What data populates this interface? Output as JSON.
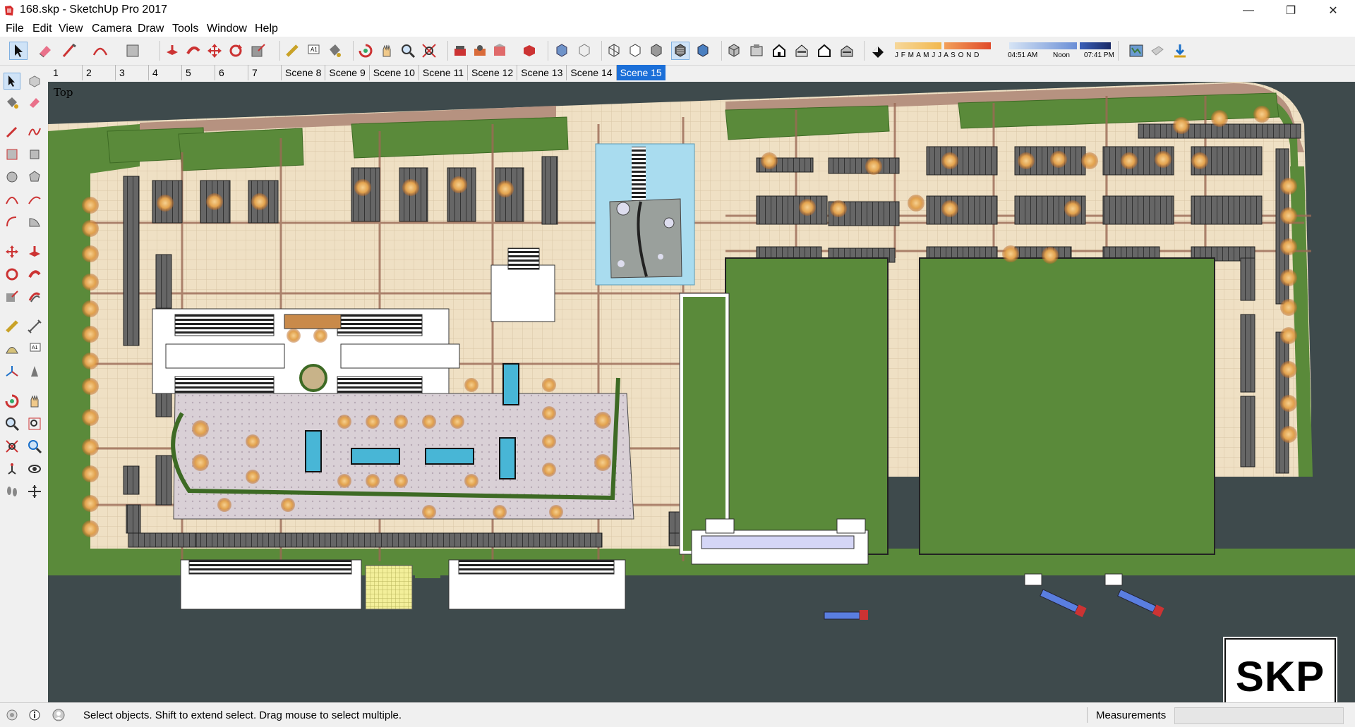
{
  "window": {
    "title": "168.skp - SketchUp Pro 2017",
    "minimize": "—",
    "maximize": "❐",
    "close": "✕"
  },
  "menu": [
    "File",
    "Edit",
    "View",
    "Camera",
    "Draw",
    "Tools",
    "Window",
    "Help"
  ],
  "shadow_months": "J F M A M J J A S O N D",
  "shadow_times": {
    "start": "04:51 AM",
    "mid": "Noon",
    "end": "07:41 PM"
  },
  "scenes": [
    "1",
    "2",
    "3",
    "4",
    "5",
    "6",
    "7",
    "Scene 8",
    "Scene 9",
    "Scene 10",
    "Scene 11",
    "Scene 12",
    "Scene 13",
    "Scene 14",
    "Scene 15"
  ],
  "active_scene": "Scene 15",
  "viewport": {
    "view_label": "Top"
  },
  "status": {
    "hint": "Select objects. Shift to extend select. Drag mouse to select multiple.",
    "measurements_label": "Measurements",
    "measurements_value": ""
  },
  "logo": {
    "text": "SKP"
  },
  "colors": {
    "active_scene": "#1b6fd8",
    "grass": "#5a8a3a",
    "paving": "#efe0c4",
    "road": "#3e4a4c"
  }
}
